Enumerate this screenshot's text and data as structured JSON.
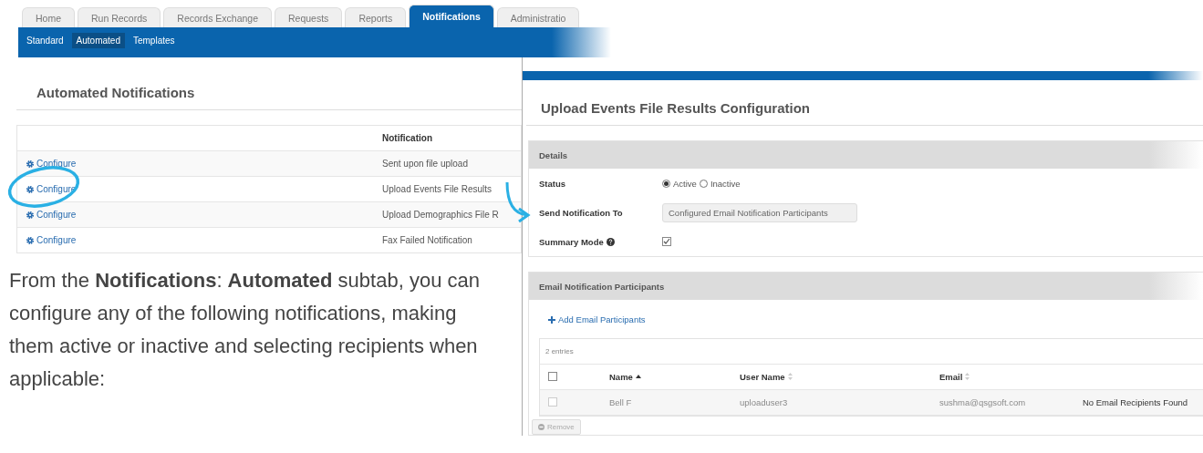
{
  "tabs": [
    {
      "label": "Home",
      "selected": false
    },
    {
      "label": "Run Records",
      "selected": false
    },
    {
      "label": "Records Exchange",
      "selected": false
    },
    {
      "label": "Requests",
      "selected": false
    },
    {
      "label": "Reports",
      "selected": false
    },
    {
      "label": "Notifications",
      "selected": true
    },
    {
      "label": "Administratio",
      "selected": false
    }
  ],
  "subtabs": [
    {
      "label": "Standard",
      "selected": false
    },
    {
      "label": "Automated",
      "selected": true
    },
    {
      "label": "Templates",
      "selected": false
    }
  ],
  "automated": {
    "title": "Automated Notifications",
    "columns": [
      "Notification"
    ],
    "rows": [
      {
        "action": "Configure",
        "notification": "Sent upon file upload"
      },
      {
        "action": "Configure",
        "notification": "Upload Events File Results"
      },
      {
        "action": "Configure",
        "notification": "Upload Demographics File R"
      },
      {
        "action": "Configure",
        "notification": "Fax Failed Notification"
      }
    ]
  },
  "description": "From the **Notifications**: **Automated** subtab, you can configure any of the following notifications, making them active or inactive and selecting recipients when applicable:",
  "config": {
    "title": "Upload Events File Results Configuration",
    "details": {
      "heading": "Details",
      "status_label": "Status",
      "status_options": [
        {
          "label": "Active",
          "selected": true
        },
        {
          "label": "Inactive",
          "selected": false
        }
      ],
      "send_label": "Send Notification To",
      "send_value": "Configured Email Notification Participants",
      "summary_label": "Summary Mode",
      "summary_checked": true
    },
    "participants": {
      "heading": "Email Notification Participants",
      "add_link": "Add Email Participants",
      "entries": "2 entries",
      "select_all_checked": false,
      "columns": [
        {
          "label": "Name",
          "sorted": true
        },
        {
          "label": "User Name",
          "sorted": false
        },
        {
          "label": "Email",
          "sorted": false
        }
      ],
      "rows": [
        {
          "checked": false,
          "disabled": true,
          "name": "Bell F",
          "user_name": "uploaduser3",
          "email": "sushma@qsgsoft.com",
          "column_5": "No Email Recipients Found"
        }
      ],
      "remove_button": {
        "label": "Remove",
        "disabled": true
      }
    }
  }
}
